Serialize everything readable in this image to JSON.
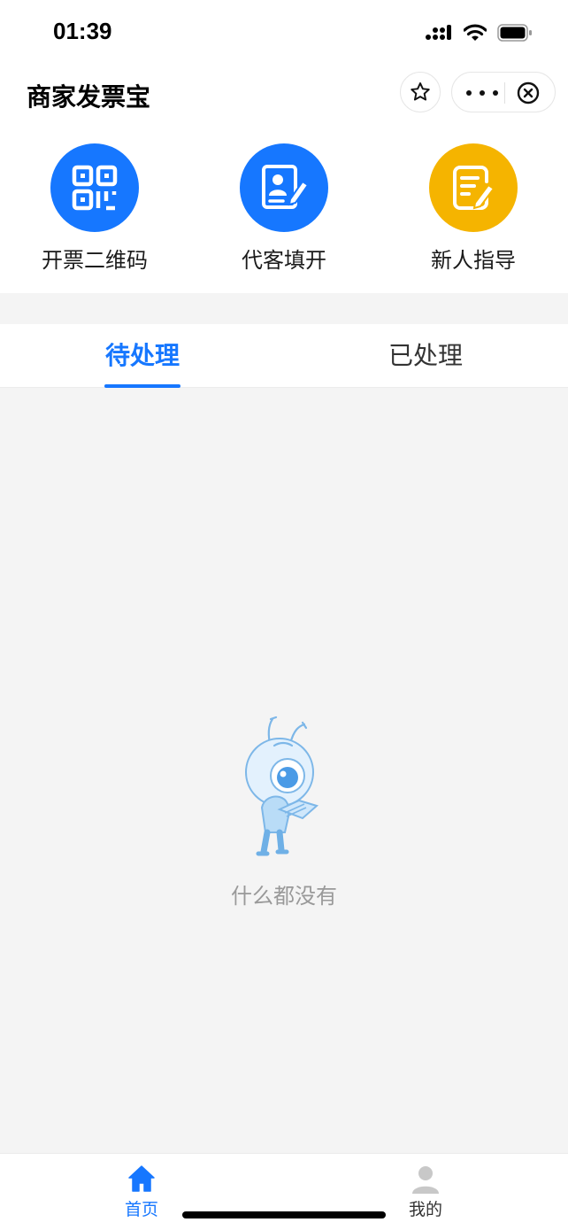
{
  "status_bar": {
    "time": "01:39"
  },
  "titlebar": {
    "title": "商家发票宝"
  },
  "quick_actions": [
    {
      "label": "开票二维码",
      "icon": "qr-code-icon",
      "color": "#1677ff"
    },
    {
      "label": "代客填开",
      "icon": "id-card-edit-icon",
      "color": "#1677ff"
    },
    {
      "label": "新人指导",
      "icon": "document-edit-icon",
      "color": "#f5b400"
    }
  ],
  "tabs": [
    {
      "label": "待处理",
      "active": true
    },
    {
      "label": "已处理",
      "active": false
    }
  ],
  "empty_state": {
    "text": "什么都没有",
    "illustration": "ant-mascot-reading-icon"
  },
  "tabbar": {
    "items": [
      {
        "label": "首页",
        "icon": "home-icon",
        "active": true
      },
      {
        "label": "我的",
        "icon": "user-icon",
        "active": false
      }
    ]
  },
  "colors": {
    "accent": "#1677ff",
    "warning": "#f5b400",
    "background": "#f4f4f4"
  }
}
